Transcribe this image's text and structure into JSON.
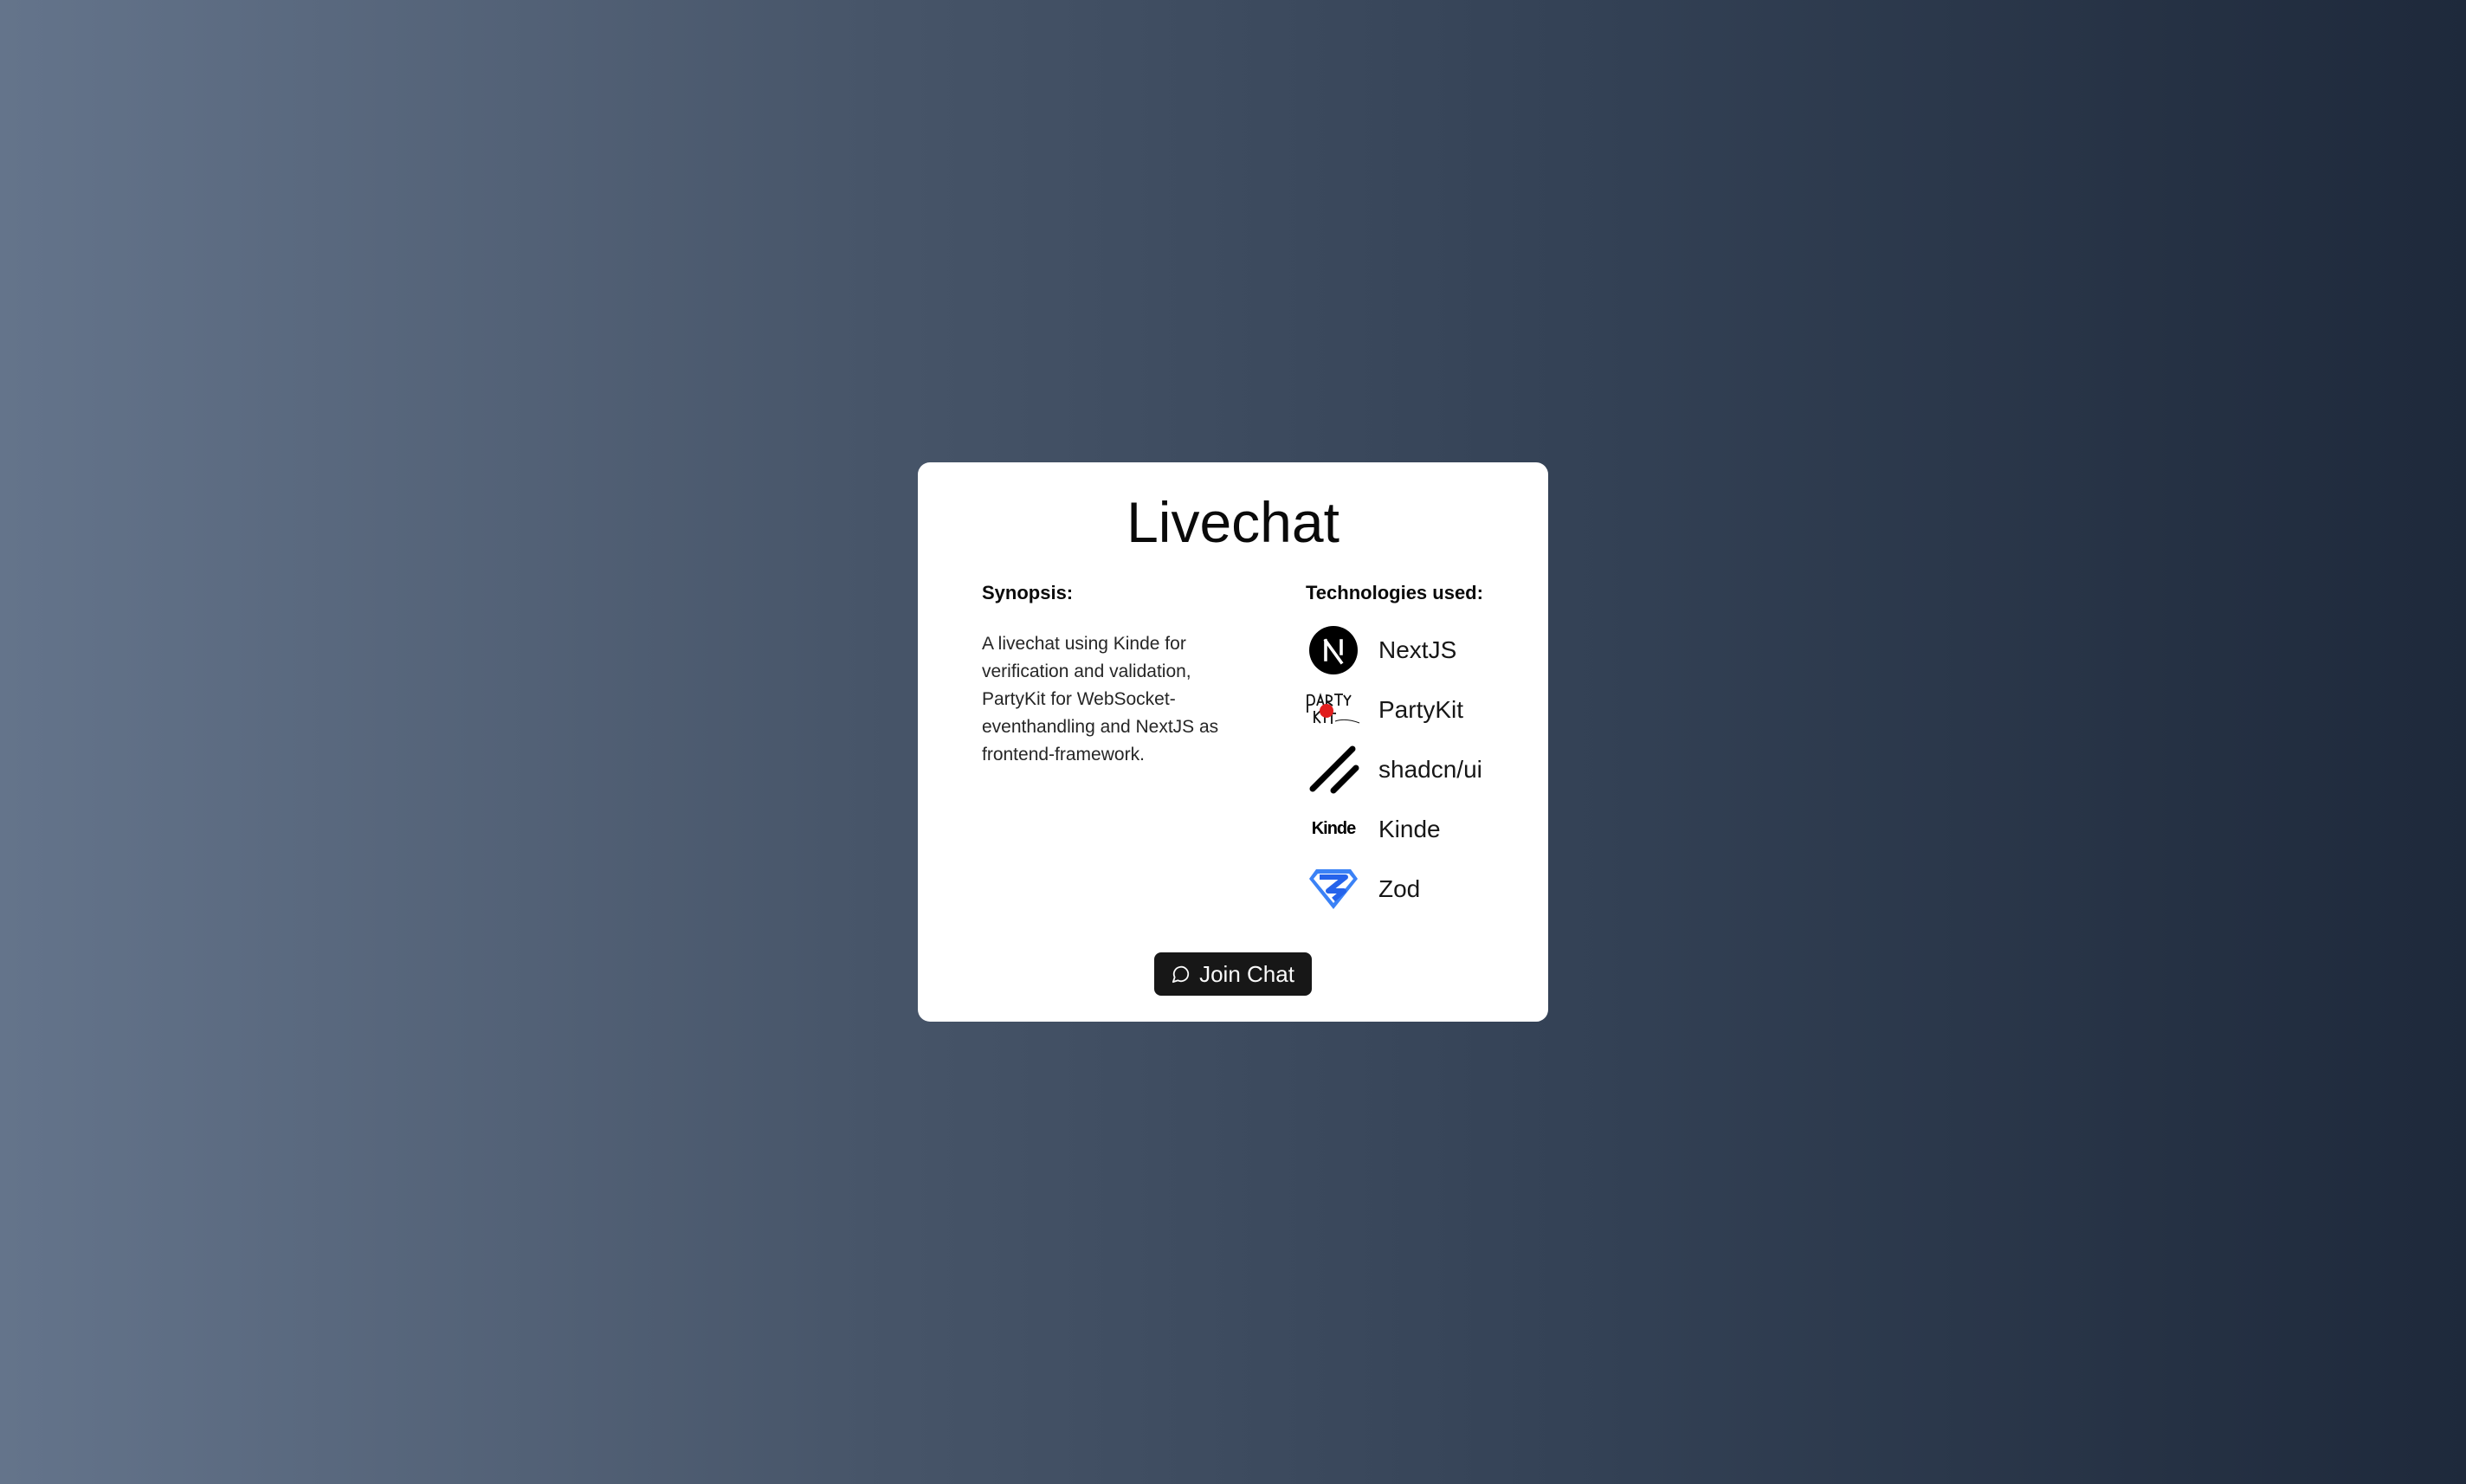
{
  "card": {
    "title": "Livechat",
    "synopsis": {
      "heading": "Synopsis:",
      "text": "A livechat using Kinde for verification and validation, PartyKit for WebSocket-eventhandling and NextJS as frontend-framework."
    },
    "technologies": {
      "heading": "Technologies used:",
      "items": [
        {
          "label": "NextJS",
          "icon": "nextjs-logo-icon"
        },
        {
          "label": "PartyKit",
          "icon": "partykit-logo-icon"
        },
        {
          "label": "shadcn/ui",
          "icon": "shadcn-logo-icon"
        },
        {
          "label": "Kinde",
          "icon": "kinde-logo-icon",
          "logo_text": "Kinde"
        },
        {
          "label": "Zod",
          "icon": "zod-logo-icon"
        }
      ]
    },
    "join_button": {
      "label": "Join Chat",
      "icon": "chat-bubble-icon"
    }
  },
  "colors": {
    "background_start": "#64748b",
    "background_end": "#1e293b",
    "card": "#ffffff",
    "button": "#171717",
    "zod_blue": "#3b82f6"
  }
}
